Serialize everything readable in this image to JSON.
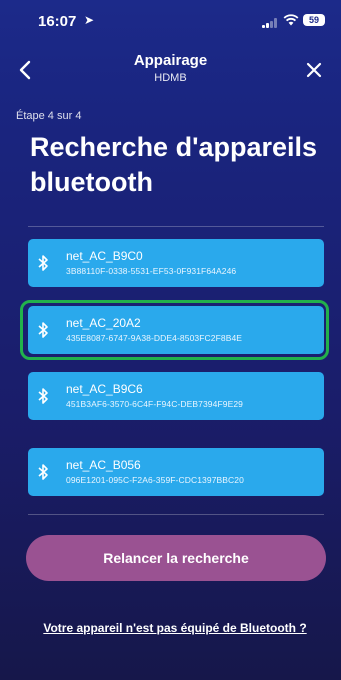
{
  "status_bar": {
    "time": "16:07",
    "battery": "59"
  },
  "nav": {
    "title": "Appairage",
    "subtitle": "HDMB"
  },
  "step_label": "Étape 4 sur 4",
  "heading": "Recherche d'appareils bluetooth",
  "devices": [
    {
      "name": "net_AC_B9C0",
      "uuid": "3B88110F-0338-5531-EF53-0F931F64A246"
    },
    {
      "name": "net_AC_20A2",
      "uuid": "435E8087-6747-9A38-DDE4-8503FC2F8B4E"
    },
    {
      "name": "net_AC_B9C6",
      "uuid": "451B3AF6-3570-6C4F-F94C-DEB7394F9E29"
    },
    {
      "name": "net_AC_B056",
      "uuid": "096E1201-095C-F2A6-359F-CDC1397BBC20"
    }
  ],
  "relaunch_button": "Relancer la recherche",
  "no_bluetooth_link": "Votre appareil n'est pas équipé de Bluetooth ?",
  "colors": {
    "device_card": "#2aa9ec",
    "highlight": "#22b14c",
    "relaunch_button": "#9a5292"
  }
}
